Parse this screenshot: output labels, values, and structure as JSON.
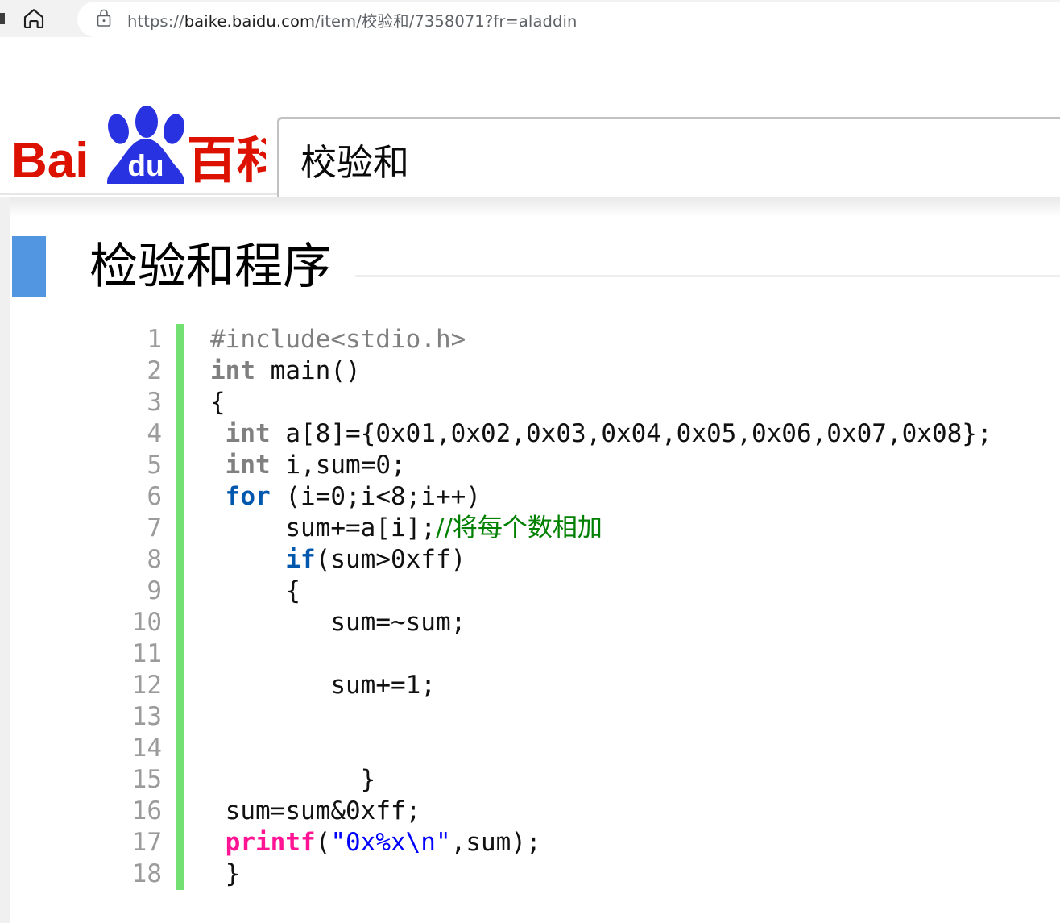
{
  "browser": {
    "home_icon": "home-icon",
    "lock_icon": "lock-icon",
    "url_scheme": "https://",
    "url_host": "baike.baidu.com",
    "url_path_a": "/item/",
    "url_keyword": "校验和",
    "url_path_b": "/7358071?fr=aladdin",
    "url_full": "https://baike.baidu.com/item/校验和/7358071?fr=aladdin"
  },
  "site": {
    "logo_text_latin": "Bai",
    "logo_text_latin2": "du",
    "logo_text_cn": "百科",
    "logo_colors": {
      "red": "#dd1100",
      "blue": "#2932e1"
    }
  },
  "search": {
    "value": "校验和",
    "placeholder": ""
  },
  "section": {
    "title": "检验和程序",
    "accent_color": "#5295e0"
  },
  "code": {
    "language": "c",
    "rail_color": "#73e073",
    "line_numbers": [
      "1",
      "2",
      "3",
      "4",
      "5",
      "6",
      "7",
      "8",
      "9",
      "10",
      "11",
      "12",
      "13",
      "14",
      "15",
      "16",
      "17",
      "18"
    ],
    "lines": [
      "#include<stdio.h>",
      "int main()",
      "{",
      " int a[8]={0x01,0x02,0x03,0x04,0x05,0x06,0x07,0x08};",
      " int i,sum=0;",
      " for (i=0;i<8;i++)",
      "     sum+=a[i];//将每个数相加",
      "     if(sum>0xff)",
      "     {",
      "        sum=~sum;",
      "",
      "        sum+=1;",
      "",
      "",
      "          }",
      " sum=sum&0xff;",
      " printf(\"0x%x\\n\",sum);",
      " }"
    ],
    "comment_text": "//将每个数相加",
    "colors": {
      "line_number": "#9b9b9b",
      "preprocessor": "#808080",
      "type_keyword": "#808080",
      "control_keyword": "#0057ae",
      "function": "#ff1493",
      "string": "#0000ff",
      "comment": "#008000",
      "plain": "#111111"
    }
  }
}
